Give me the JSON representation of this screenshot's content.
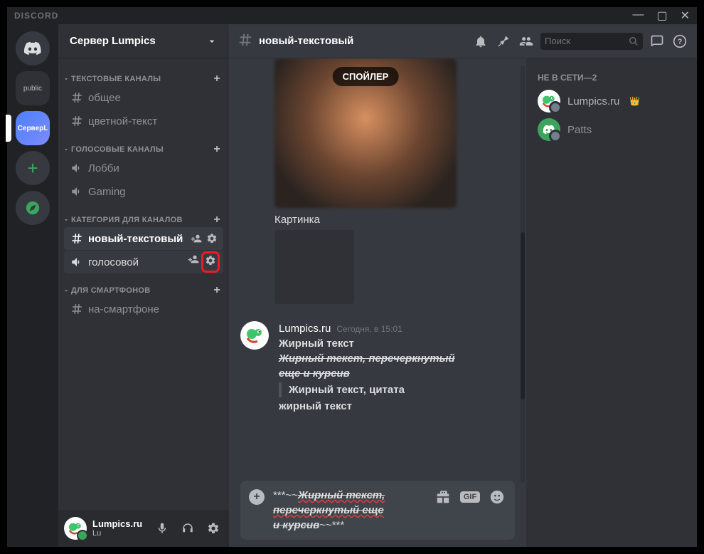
{
  "titlebar": {
    "brand": "DISCORD"
  },
  "guilds": {
    "folder_label": "public",
    "selected_label": "СерверL"
  },
  "server": {
    "name": "Сервер Lumpics"
  },
  "categories": {
    "text": {
      "label": "ТЕКСТОВЫЕ КАНАЛЫ"
    },
    "voice": {
      "label": "ГОЛОСОВЫЕ КАНАЛЫ"
    },
    "custom": {
      "label": "КАТЕГОРИЯ ДЛЯ КАНАЛОВ"
    },
    "phones": {
      "label": "ДЛЯ СМАРТФОНОВ"
    }
  },
  "channels": {
    "general": "общее",
    "coloredText": "цветной-текст",
    "lobby": "Лобби",
    "gaming": "Gaming",
    "newText": "новый-текстовый",
    "voice": "голосовой",
    "onPhone": "на-смартфоне"
  },
  "userPanel": {
    "name": "Lumpics.ru",
    "status": "Lu"
  },
  "chatHeader": {
    "channel": "новый-текстовый",
    "searchPlaceholder": "Поиск"
  },
  "spoiler": {
    "badge": "СПОЙЛЕР",
    "caption": "Картинка"
  },
  "message": {
    "author": "Lumpics.ru",
    "timestamp": "Сегодня, в 15:01",
    "line1": "Жирный текст",
    "line2a": "Жирный текст, перечеркнутый",
    "line2b": "еще и курсив",
    "line3": "Жирный текст, цитата",
    "line4": "жирный текст"
  },
  "input": {
    "pre": "***~~",
    "l1": "Жирный текст,",
    "l2": "перечеркнутый еще",
    "l3": "и курсив",
    "post": "~~***"
  },
  "gif": "GIF",
  "members": {
    "header": "НЕ В СЕТИ—2",
    "m1": "Lumpics.ru",
    "m2": "Patts"
  }
}
